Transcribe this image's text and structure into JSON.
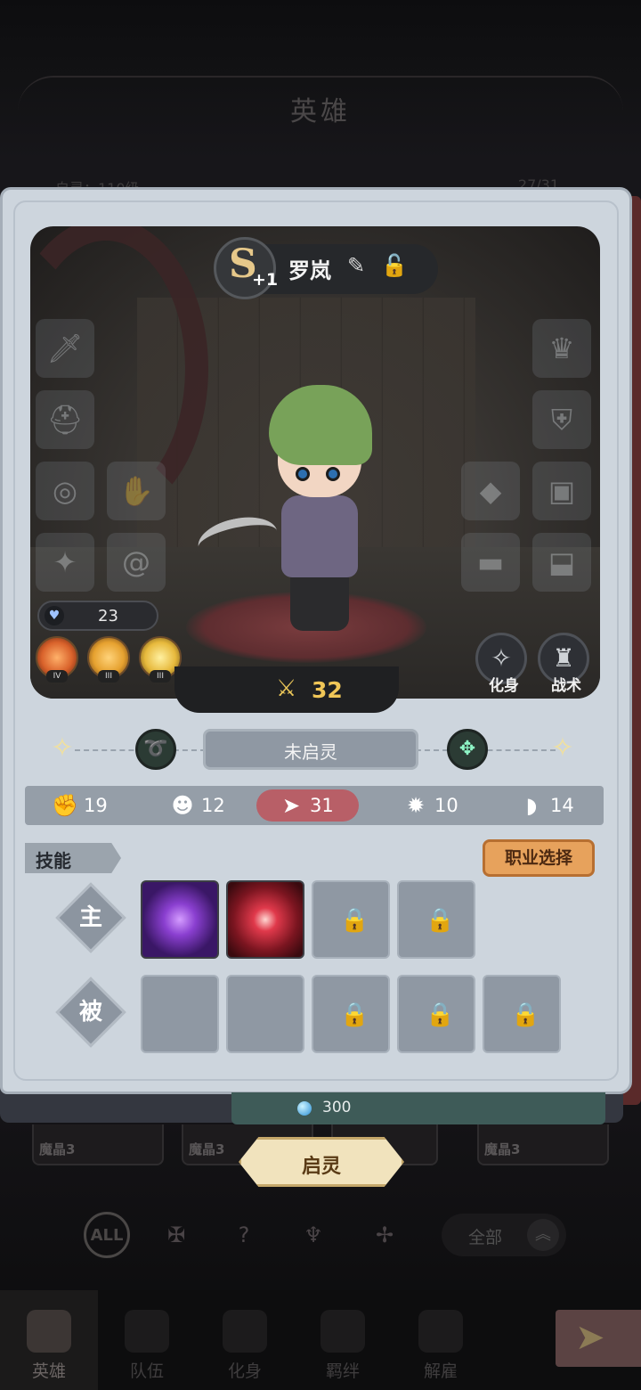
{
  "background": {
    "title": "英雄",
    "subtitle_left": "自灵：110级",
    "subtitle_right": "27/31",
    "cards": [
      "魔晶3",
      "魔晶3",
      "魔晶3",
      "魔晶3"
    ],
    "filter_all_icon": "ALL",
    "filter_dropdown": "全部"
  },
  "nav": {
    "items": [
      "英雄",
      "队伍",
      "化身",
      "羁绊",
      "解雇"
    ],
    "active_index": 0
  },
  "hero": {
    "rank": "S",
    "rank_plus": "+1",
    "name": "罗岚",
    "hp_value": "23",
    "power": "32",
    "traits": [
      {
        "level": "IV",
        "color": "#d9622b"
      },
      {
        "level": "III",
        "color": "#e6a12f"
      },
      {
        "level": "III",
        "color": "#e7b93c"
      }
    ],
    "avatar_button_label": "化身",
    "tactic_button_label": "战术"
  },
  "spirit": {
    "status": "未启灵"
  },
  "stats": [
    {
      "icon": "fist-icon",
      "value": "19"
    },
    {
      "icon": "head-icon",
      "value": "12"
    },
    {
      "icon": "boot-icon",
      "value": "31",
      "highlight": true
    },
    {
      "icon": "spark-icon",
      "value": "10"
    },
    {
      "icon": "foot-icon",
      "value": "14"
    }
  ],
  "skills": {
    "header": "技能",
    "job_select_label": "职业选择",
    "active_label": "主",
    "passive_label": "被"
  },
  "awaken": {
    "cost": "300",
    "button_label": "启灵"
  },
  "colors": {
    "accent_gold": "#f0c657",
    "stat_highlight": "#b85f67",
    "job_button": "#e7a25c"
  }
}
